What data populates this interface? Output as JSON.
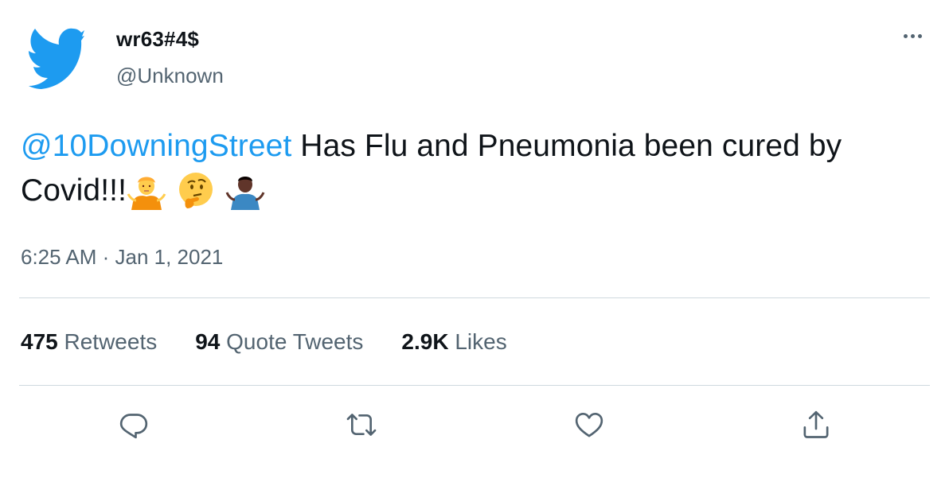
{
  "user": {
    "name": "wr63#4$",
    "handle": "@Unknown"
  },
  "tweet": {
    "mention": "@10DowningStreet",
    "text": " Has Flu and Pneumonia been cured by Covid!!!",
    "emojis": [
      "person-shrugging-emoji",
      "thinking-face-emoji",
      "man-shrugging-dark-skin-emoji"
    ],
    "timestamp": "6:25 AM · Jan 1, 2021"
  },
  "stats": {
    "retweets_count": "475",
    "retweets_label": "Retweets",
    "quotes_count": "94",
    "quotes_label": "Quote Tweets",
    "likes_count": "2.9K",
    "likes_label": "Likes"
  },
  "actions": [
    "reply-icon",
    "retweet-icon",
    "like-icon",
    "share-icon"
  ],
  "colors": {
    "brand": "#1d9bf0",
    "text": "#0f1419",
    "secondary": "#536471",
    "divider": "#cfd9de"
  }
}
